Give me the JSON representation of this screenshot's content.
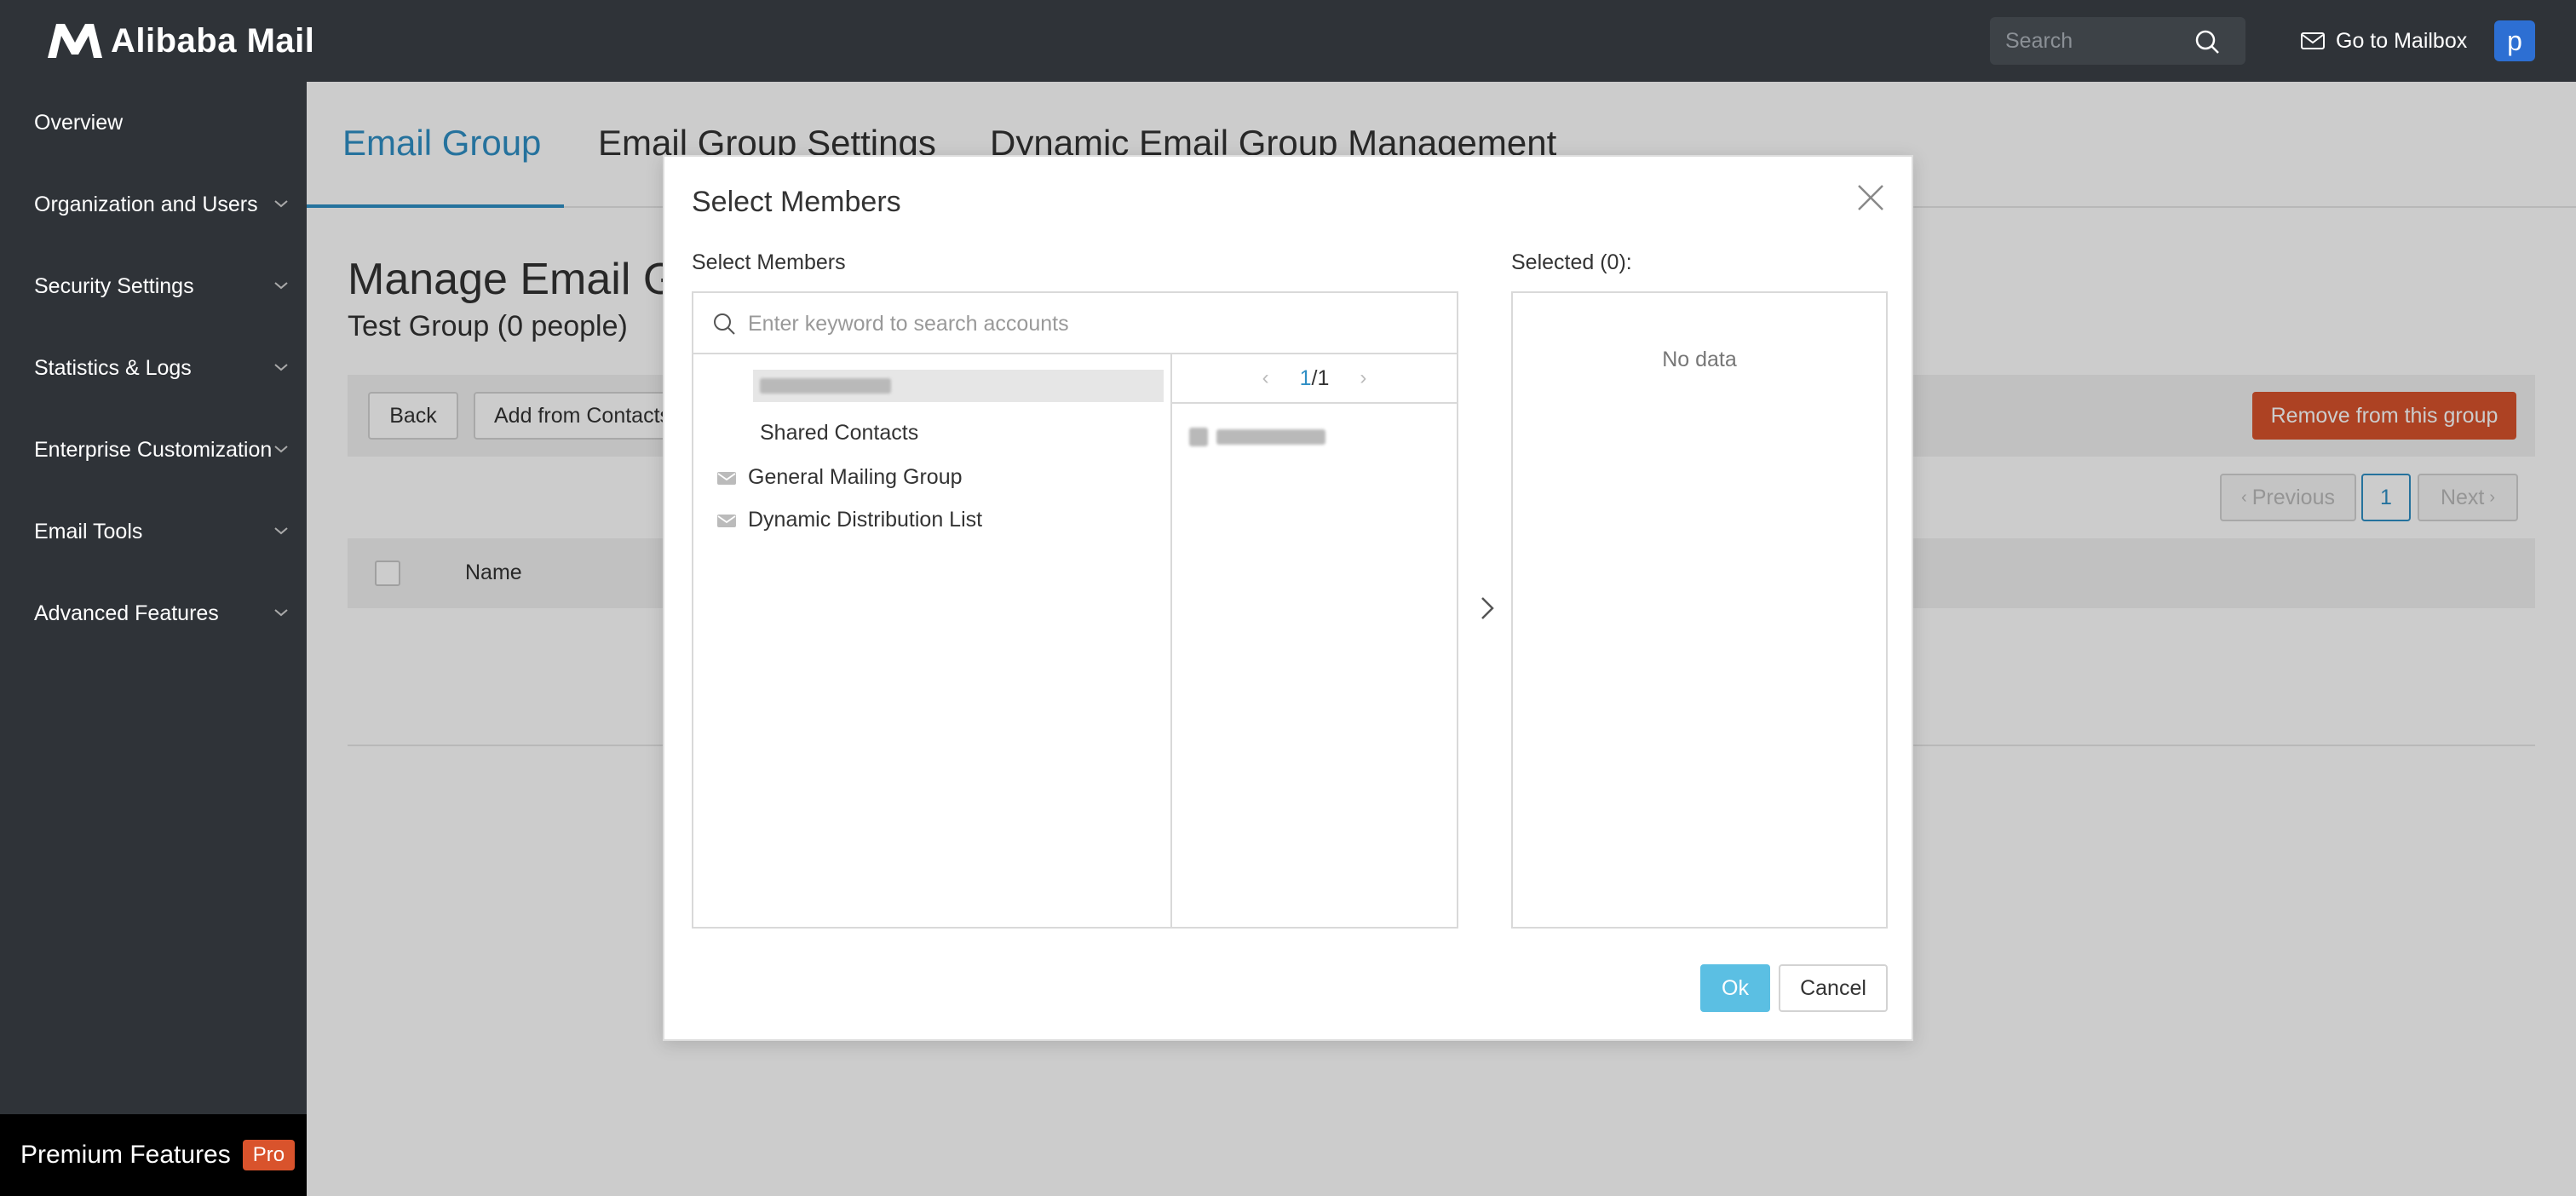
{
  "app": {
    "logo_text": "Alibaba Mail",
    "logo_icon": "m-logo-icon"
  },
  "topbar": {
    "search_placeholder": "Search",
    "goto_label": "Go to Mailbox",
    "avatar_letter": "p"
  },
  "sidebar": {
    "items": [
      {
        "label": "Overview",
        "expandable": false
      },
      {
        "label": "Organization and Users",
        "expandable": true
      },
      {
        "label": "Security Settings",
        "expandable": true
      },
      {
        "label": "Statistics & Logs",
        "expandable": true
      },
      {
        "label": "Enterprise Customization",
        "expandable": true
      },
      {
        "label": "Email Tools",
        "expandable": true
      },
      {
        "label": "Advanced Features",
        "expandable": true
      }
    ],
    "premium_label": "Premium Features",
    "premium_badge": "Pro"
  },
  "main": {
    "tabs": [
      {
        "label": "Email Group",
        "active": true
      },
      {
        "label": "Email Group Settings",
        "active": false
      },
      {
        "label": "Dynamic Email Group Management",
        "active": false
      }
    ],
    "title": "Manage Email Gr",
    "subtitle": "Test Group (0 people)",
    "toolbar": {
      "back_label": "Back",
      "add_label": "Add from Contacts",
      "remove_label": "Remove from this group"
    },
    "pager": {
      "previous_label": "Previous",
      "current_page": "1",
      "next_label": "Next"
    },
    "table": {
      "columns": [
        "Name"
      ]
    }
  },
  "modal": {
    "title": "Select Members",
    "left_label": "Select Members",
    "right_label": "Selected (0):",
    "search_placeholder": "Enter keyword to search accounts",
    "tree": {
      "items": [
        {
          "label": "Shared Contacts",
          "icon": "none"
        },
        {
          "label": "General Mailing Group",
          "icon": "mail-group-icon"
        },
        {
          "label": "Dynamic Distribution List",
          "icon": "mail-group-icon"
        }
      ]
    },
    "list_pager": {
      "current": "1",
      "total": "/1"
    },
    "no_data": "No data",
    "ok_label": "Ok",
    "cancel_label": "Cancel"
  },
  "colors": {
    "sidebar_bg": "#2f3338",
    "accent": "#2f8fc5",
    "danger": "#d9532c",
    "ok": "#5bbfe3"
  }
}
